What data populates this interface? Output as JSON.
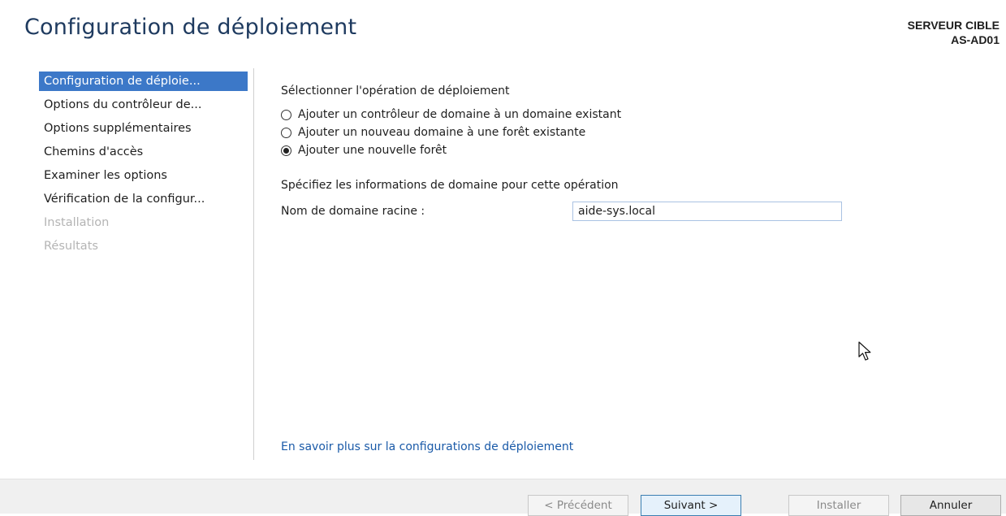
{
  "header": {
    "title": "Configuration de déploiement",
    "target_server_label": "SERVEUR CIBLE",
    "target_server_name": "AS-AD01"
  },
  "nav": {
    "items": [
      {
        "label": "Configuration de déploie...",
        "state": "active"
      },
      {
        "label": "Options du contrôleur de...",
        "state": "normal"
      },
      {
        "label": "Options supplémentaires",
        "state": "normal"
      },
      {
        "label": "Chemins d'accès",
        "state": "normal"
      },
      {
        "label": "Examiner les options",
        "state": "normal"
      },
      {
        "label": "Vérification de la configur...",
        "state": "normal"
      },
      {
        "label": "Installation",
        "state": "disabled"
      },
      {
        "label": "Résultats",
        "state": "disabled"
      }
    ]
  },
  "content": {
    "operation_heading": "Sélectionner l'opération de déploiement",
    "options": [
      {
        "label": "Ajouter un contrôleur de domaine à un domaine existant",
        "checked": false
      },
      {
        "label": "Ajouter un nouveau domaine à une forêt existante",
        "checked": false
      },
      {
        "label": "Ajouter une nouvelle forêt",
        "checked": true
      }
    ],
    "domain_heading": "Spécifiez les informations de domaine pour cette opération",
    "root_domain_label": "Nom de domaine racine :",
    "root_domain_value": "aide-sys.local",
    "learn_more_link": "En savoir plus sur la configurations de déploiement"
  },
  "footer": {
    "previous_label": "< Précédent",
    "next_label": "Suivant >",
    "install_label": "Installer",
    "cancel_label": "Annuler"
  },
  "colors": {
    "accent": "#3c78c8",
    "title": "#1e3a5f",
    "link": "#1a5aa8"
  },
  "icons": {
    "cursor": "mouse-pointer-icon"
  }
}
